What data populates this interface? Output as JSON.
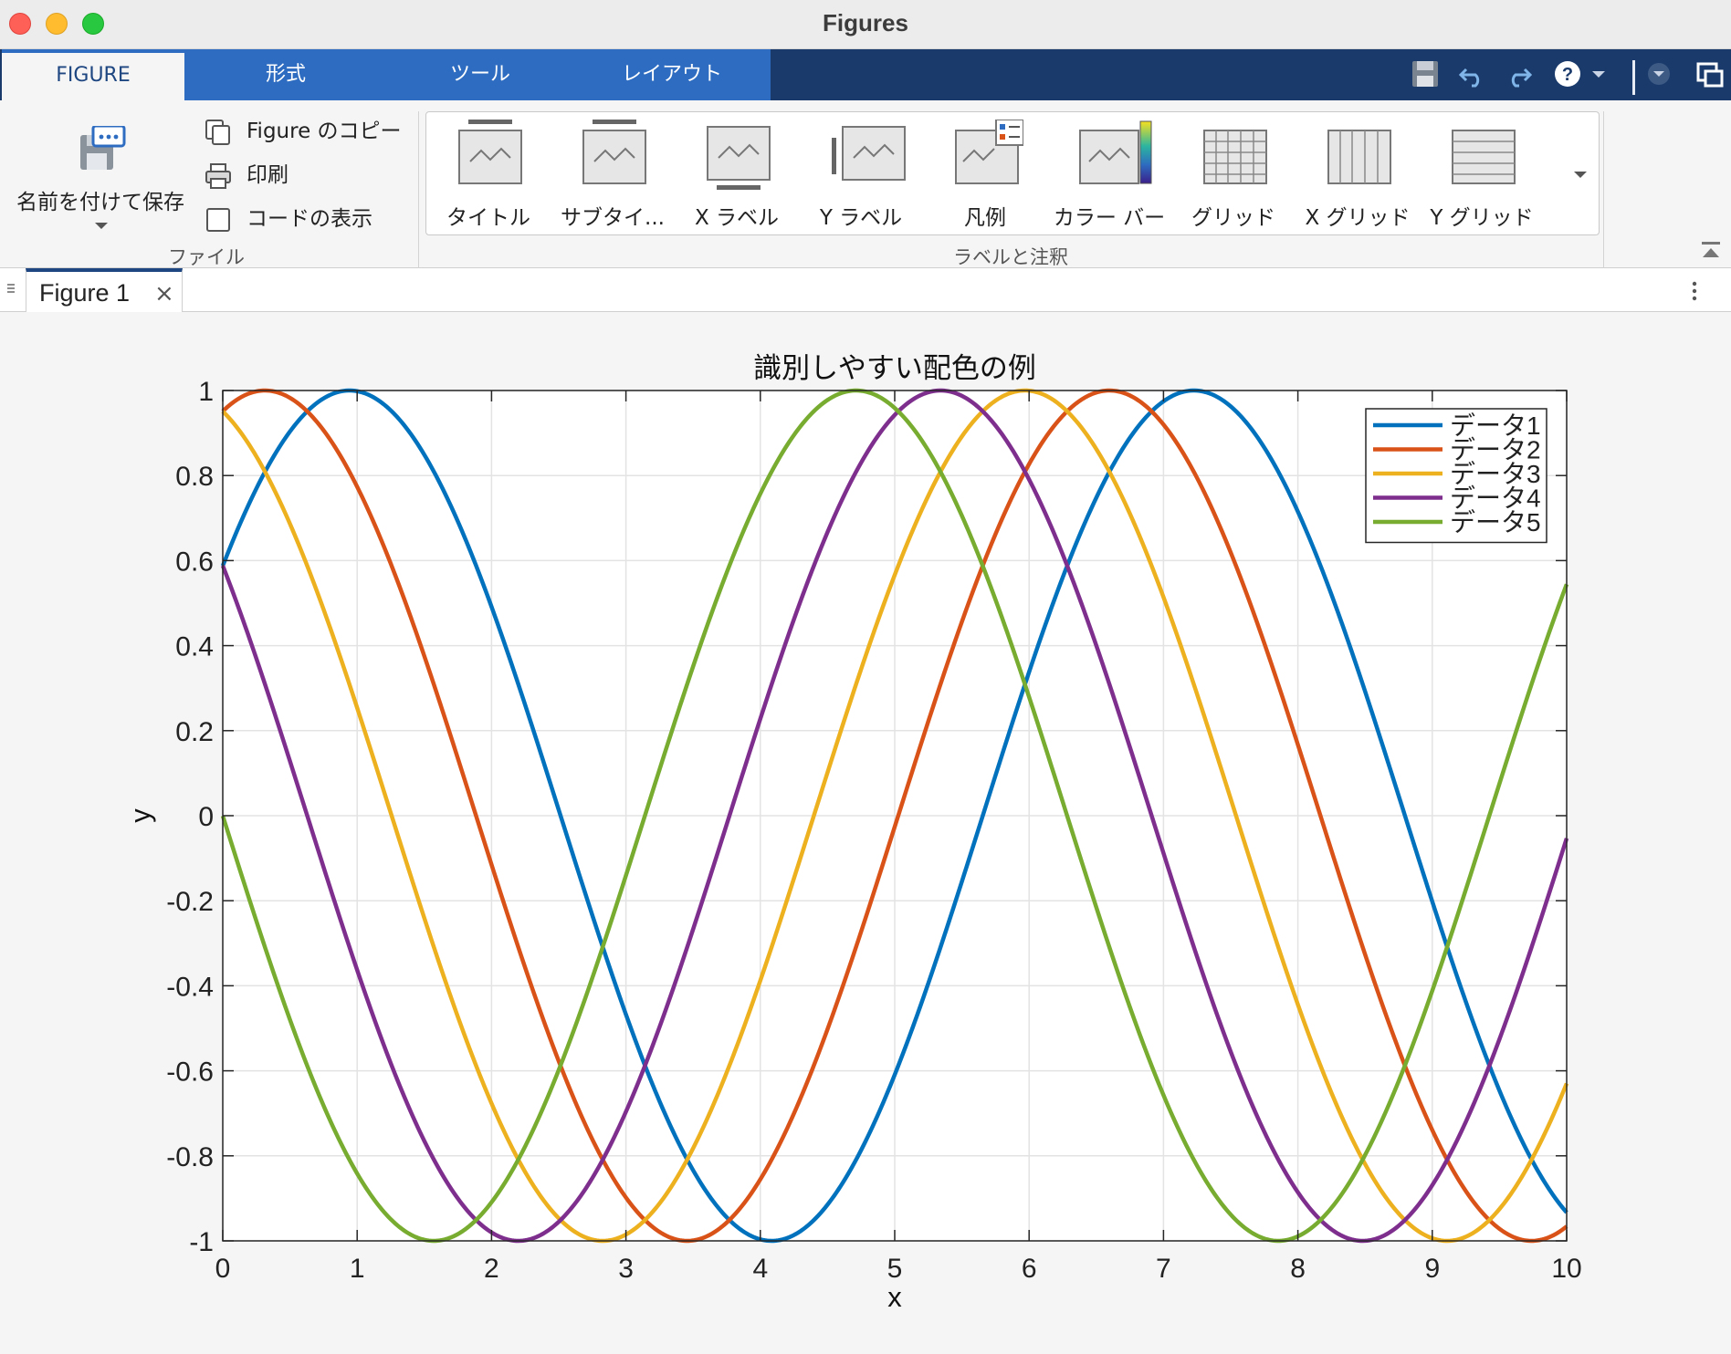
{
  "window": {
    "title": "Figures",
    "traffic_light_colors": [
      "#fe5f57",
      "#febc2e",
      "#28c840"
    ]
  },
  "ribbon": {
    "tabs": [
      {
        "label": "FIGURE",
        "active": true
      },
      {
        "label": "形式",
        "active": false
      },
      {
        "label": "ツール",
        "active": false
      },
      {
        "label": "レイアウト",
        "active": false
      }
    ],
    "quick_access_icons": [
      "save-icon",
      "undo-icon",
      "redo-icon",
      "help-icon",
      "dropdown-arrow-icon",
      "menu-options-icon",
      "undock-icon"
    ],
    "file_group": {
      "label": "ファイル",
      "save_as": "名前を付けて保存",
      "copy_figure": "Figure のコピー",
      "print": "印刷",
      "show_code": "コードの表示"
    },
    "labels_group": {
      "label": "ラベルと注釈",
      "items": [
        "タイトル",
        "サブタイ...",
        "X ラベル",
        "Y ラベル",
        "凡例",
        "カラー バー",
        "グリッド",
        "X グリッド",
        "Y グリッド"
      ]
    }
  },
  "document_tabs": {
    "figure_tab": "Figure 1"
  },
  "accent_colors": {
    "ribbon_tab_bar": "#1a3a6b",
    "ribbon_tab": "#2d6cc0"
  },
  "chart_data": {
    "type": "line",
    "title": "識別しやすい配色の例",
    "xlabel": "x",
    "ylabel": "y",
    "xlim": [
      0,
      10
    ],
    "ylim": [
      -1,
      1
    ],
    "xticks": [
      0,
      1,
      2,
      3,
      4,
      5,
      6,
      7,
      8,
      9,
      10
    ],
    "yticks": [
      -1,
      -0.8,
      -0.6,
      -0.4,
      -0.2,
      0,
      0.2,
      0.4,
      0.6,
      0.8,
      1
    ],
    "ytick_labels": [
      "-1",
      "-0.8",
      "-0.6",
      "-0.4",
      "-0.2",
      "0",
      "0.2",
      "0.4",
      "0.6",
      "0.8",
      "1"
    ],
    "grid": true,
    "legend_position": "top-right",
    "series": [
      {
        "name": "データ1",
        "color": "#0072BD",
        "function": "sin(x + 0.628)",
        "x": [
          0,
          1,
          2,
          3,
          4,
          5,
          6,
          7,
          8,
          9,
          10
        ],
        "y": [
          0.59,
          1.0,
          0.47,
          -0.7,
          -0.99,
          -0.34,
          0.8,
          0.96,
          0.2,
          -0.89,
          -0.93
        ]
      },
      {
        "name": "データ2",
        "color": "#D95319",
        "function": "sin(x + 1.257)",
        "x": [
          0,
          1,
          2,
          3,
          4,
          5,
          6,
          7,
          8,
          9,
          10
        ],
        "y": [
          0.95,
          0.77,
          -0.16,
          -0.94,
          -0.82,
          0.07,
          0.9,
          0.86,
          0.02,
          -0.83,
          -0.97
        ]
      },
      {
        "name": "データ3",
        "color": "#EDB120",
        "function": "sin(x + 1.885)",
        "x": [
          0,
          1,
          2,
          3,
          4,
          5,
          6,
          7,
          8,
          9,
          10
        ],
        "y": [
          0.95,
          0.26,
          -0.7,
          -0.98,
          -0.31,
          0.67,
          0.99,
          0.3,
          -0.7,
          -0.98,
          -0.63
        ]
      },
      {
        "name": "データ4",
        "color": "#7E2F8E",
        "function": "sin(x + 2.513)",
        "x": [
          0,
          1,
          2,
          3,
          4,
          5,
          6,
          7,
          8,
          9,
          10
        ],
        "y": [
          0.59,
          -0.34,
          -0.99,
          -0.69,
          0.27,
          0.98,
          0.78,
          -0.17,
          -0.93,
          -0.77,
          -0.06
        ]
      },
      {
        "name": "データ5",
        "color": "#77AC30",
        "function": "sin(x + 3.142)",
        "x": [
          0,
          1,
          2,
          3,
          4,
          5,
          6,
          7,
          8,
          9,
          10
        ],
        "y": [
          0.0,
          -0.84,
          -0.91,
          -0.14,
          0.76,
          0.96,
          0.28,
          -0.66,
          -0.99,
          -0.41,
          0.54
        ]
      }
    ]
  }
}
